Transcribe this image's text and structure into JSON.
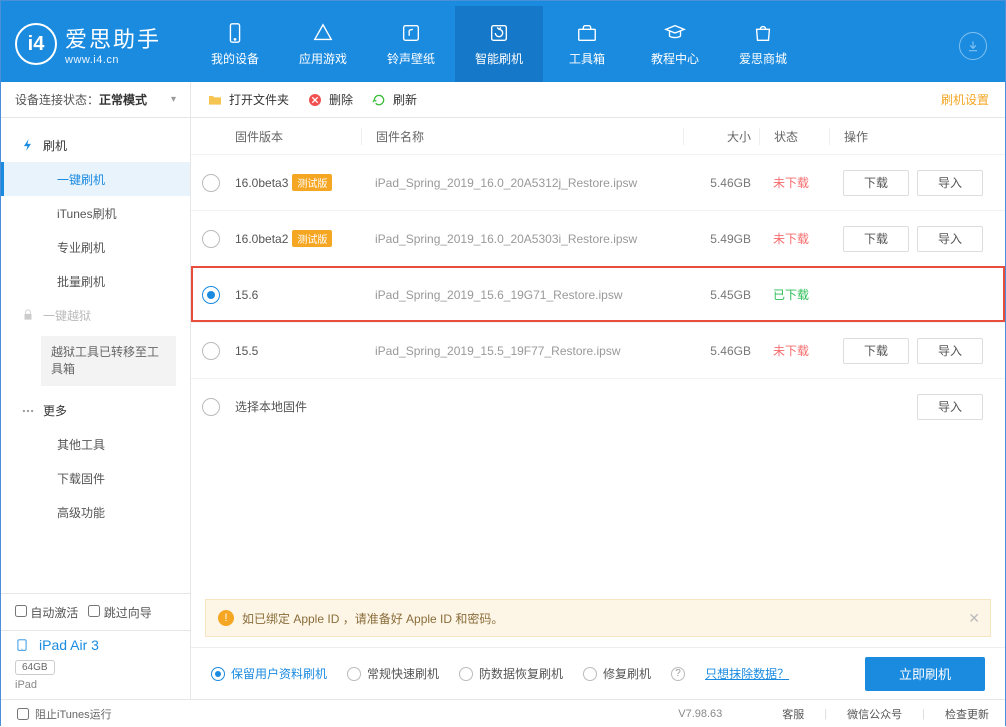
{
  "app": {
    "name_cn": "爱思助手",
    "name_en": "www.i4.cn"
  },
  "nav": [
    {
      "label": "我的设备"
    },
    {
      "label": "应用游戏"
    },
    {
      "label": "铃声壁纸"
    },
    {
      "label": "智能刷机"
    },
    {
      "label": "工具箱"
    },
    {
      "label": "教程中心"
    },
    {
      "label": "爱思商城"
    }
  ],
  "status": {
    "label": "设备连接状态：",
    "value": "正常模式"
  },
  "sidebar": {
    "root_flash": "刷机",
    "items": [
      "一键刷机",
      "iTunes刷机",
      "专业刷机",
      "批量刷机"
    ],
    "jailbreak": "一键越狱",
    "jb_notice": "越狱工具已转移至工具箱",
    "more": "更多",
    "more_items": [
      "其他工具",
      "下载固件",
      "高级功能"
    ],
    "auto_activate": "自动激活",
    "skip_guide": "跳过向导",
    "device_name": "iPad Air 3",
    "capacity": "64GB",
    "device_type": "iPad"
  },
  "toolbar": {
    "open": "打开文件夹",
    "delete": "删除",
    "refresh": "刷新",
    "settings": "刷机设置"
  },
  "table": {
    "headers": {
      "ver": "固件版本",
      "name": "固件名称",
      "size": "大小",
      "status": "状态",
      "ops": "操作"
    },
    "download_btn": "下载",
    "import_btn": "导入",
    "local_firmware": "选择本地固件",
    "rows": [
      {
        "ver": "16.0beta3",
        "beta": "测试版",
        "name": "iPad_Spring_2019_16.0_20A5312j_Restore.ipsw",
        "size": "5.46GB",
        "status": "未下载",
        "status_cls": "no",
        "selected": false,
        "ops": true
      },
      {
        "ver": "16.0beta2",
        "beta": "测试版",
        "name": "iPad_Spring_2019_16.0_20A5303i_Restore.ipsw",
        "size": "5.49GB",
        "status": "未下载",
        "status_cls": "no",
        "selected": false,
        "ops": true
      },
      {
        "ver": "15.6",
        "beta": "",
        "name": "iPad_Spring_2019_15.6_19G71_Restore.ipsw",
        "size": "5.45GB",
        "status": "已下载",
        "status_cls": "yes",
        "selected": true,
        "ops": false
      },
      {
        "ver": "15.5",
        "beta": "",
        "name": "iPad_Spring_2019_15.5_19F77_Restore.ipsw",
        "size": "5.46GB",
        "status": "未下载",
        "status_cls": "no",
        "selected": false,
        "ops": true
      }
    ]
  },
  "notice": "如已绑定 Apple ID ，请准备好 Apple ID 和密码。",
  "options": {
    "o1": "保留用户资料刷机",
    "o2": "常规快速刷机",
    "o3": "防数据恢复刷机",
    "o4": "修复刷机",
    "erase_link": "只想抹除数据？",
    "flash_btn": "立即刷机"
  },
  "footer": {
    "block_itunes": "阻止iTunes运行",
    "version": "V7.98.63",
    "cs": "客服",
    "wechat": "微信公众号",
    "update": "检查更新"
  }
}
